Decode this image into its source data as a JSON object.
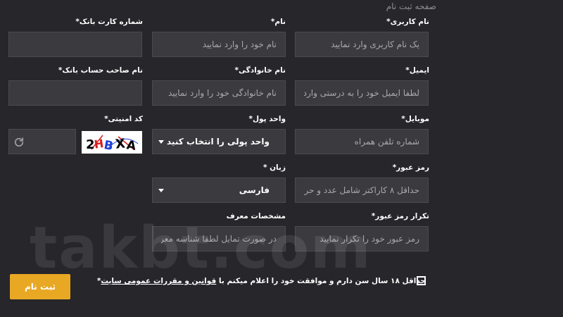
{
  "page": {
    "title": "صفحه ثبت نام"
  },
  "col1": {
    "username": {
      "label": "نام کاربری*",
      "placeholder": "یک نام کاربری وارد نمایید"
    },
    "email": {
      "label": "ایمیل*",
      "placeholder": "لطفا ایمیل خود را به درستی وارد..."
    },
    "mobile": {
      "label": "موبایل*",
      "placeholder": "شماره تلفن همراه"
    },
    "password": {
      "label": "رمز عبور*",
      "placeholder": "حداقل ۸ کاراکتر شامل عدد و حر..."
    },
    "password_confirm": {
      "label": "تکرار رمز عبور*",
      "placeholder": "رمز عبور خود را تکرار نمایید"
    }
  },
  "col2": {
    "first_name": {
      "label": "نام*",
      "placeholder": "نام خود را وارد نمایید"
    },
    "last_name": {
      "label": "نام خانوادگی*",
      "placeholder": "نام خانوادگی خود را وارد نمایید"
    },
    "currency": {
      "label": "واحد پول*",
      "value": "واحد پولی را انتخاب کنید"
    },
    "language": {
      "label": "زبان *",
      "value": "فارسی"
    },
    "referrer": {
      "label": "مشخصات معرف",
      "placeholder": "در صورت تمایل لطفا شناسه معر..."
    }
  },
  "col3": {
    "card_number": {
      "label": "شماره کارت بانک*",
      "placeholder": ""
    },
    "account_holder": {
      "label": "نام صاحب حساب بانک*",
      "placeholder": ""
    },
    "captcha": {
      "label": "کد امنیتی*",
      "placeholder": "",
      "image_text": "2HBXA"
    }
  },
  "terms": {
    "prefix": "حداقل ۱۸ سال سن دارم و موافقت خود را اعلام میکنم با",
    "link": "قوانین و مقررات عمومی سایت",
    "suffix": "*"
  },
  "submit": {
    "label": "ثبت نام"
  },
  "watermark": "takbt.com",
  "icons": {
    "refresh": "refresh-icon",
    "dropdown": "chevron-down-icon"
  },
  "colors": {
    "background": "#26262b",
    "field": "#3a3a3f",
    "accent": "#e8a824"
  }
}
